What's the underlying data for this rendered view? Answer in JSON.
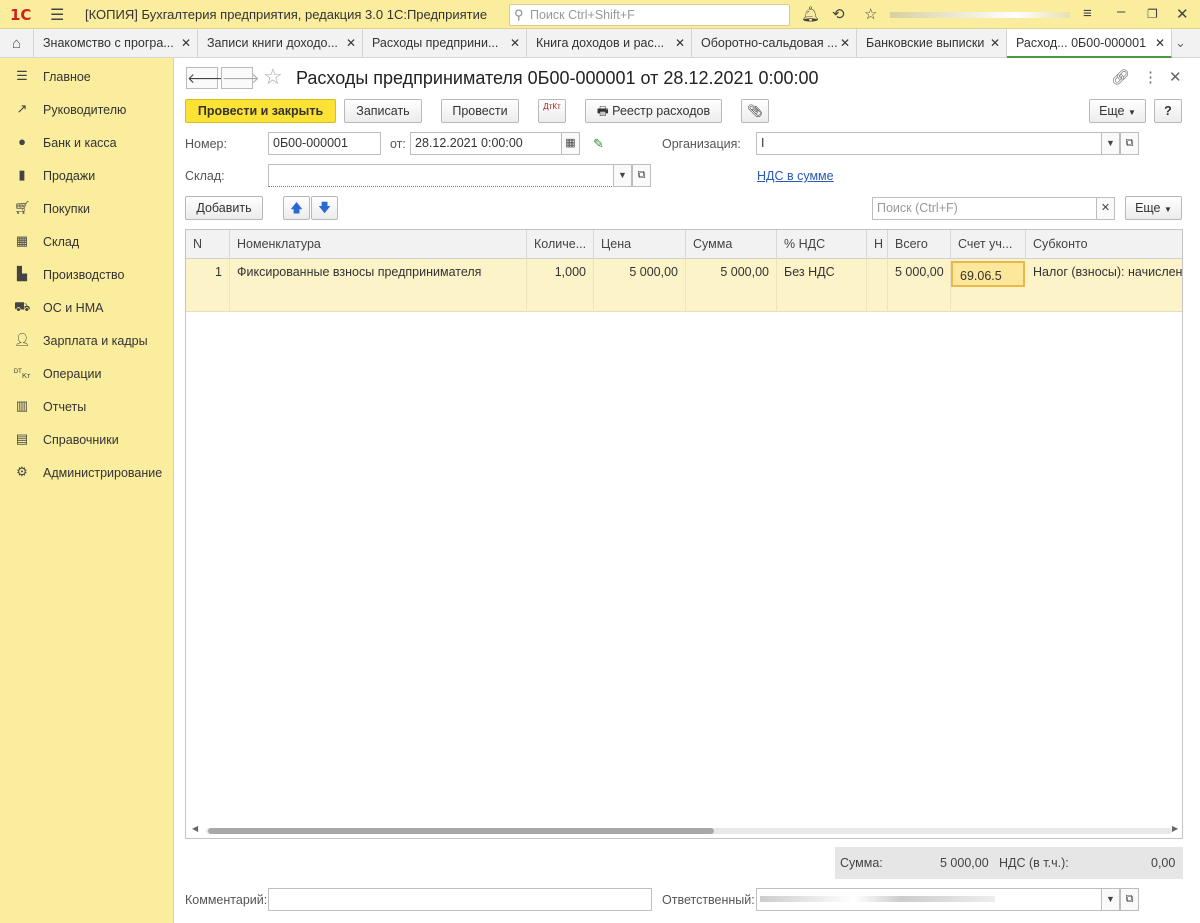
{
  "app": {
    "logo": "1С",
    "title": "[КОПИЯ] Бухгалтерия предприятия, редакция 3.0 1С:Предприятие",
    "search_placeholder": "Поиск Ctrl+Shift+F"
  },
  "tabs": [
    {
      "label": "Знакомство с програ..."
    },
    {
      "label": "Записи книги доходо..."
    },
    {
      "label": "Расходы предприни..."
    },
    {
      "label": "Книга доходов и рас..."
    },
    {
      "label": "Оборотно-сальдовая ..."
    },
    {
      "label": "Банковские выписки"
    },
    {
      "label": "Расход...  0Б00-000001"
    }
  ],
  "sidebar": {
    "items": [
      {
        "label": "Главное",
        "icon": "menu-icon"
      },
      {
        "label": "Руководителю",
        "icon": "trend-icon"
      },
      {
        "label": "Банк и касса",
        "icon": "coin-icon"
      },
      {
        "label": "Продажи",
        "icon": "bag-icon"
      },
      {
        "label": "Покупки",
        "icon": "cart-icon"
      },
      {
        "label": "Склад",
        "icon": "warehouse-icon"
      },
      {
        "label": "Производство",
        "icon": "factory-icon"
      },
      {
        "label": "ОС и НМА",
        "icon": "truck-icon"
      },
      {
        "label": "Зарплата и кадры",
        "icon": "person-icon"
      },
      {
        "label": "Операции",
        "icon": "dt-kt-icon"
      },
      {
        "label": "Отчеты",
        "icon": "chart-icon"
      },
      {
        "label": "Справочники",
        "icon": "book-icon"
      },
      {
        "label": "Администрирование",
        "icon": "gear-icon"
      }
    ]
  },
  "document": {
    "title": "Расходы предпринимателя 0Б00-000001 от 28.12.2021 0:00:00"
  },
  "toolbar": {
    "post_close": "Провести и закрыть",
    "save": "Записать",
    "post": "Провести",
    "dtkt": "ДтКт",
    "registry": "Реестр расходов",
    "more": "Еще"
  },
  "form": {
    "number_label": "Номер:",
    "number_value": "0Б00-000001",
    "date_label": "от:",
    "date_value": "28.12.2021  0:00:00",
    "org_label": "Организация:",
    "org_value": "І",
    "warehouse_label": "Склад:",
    "warehouse_value": "",
    "vat_link": "НДС в сумме"
  },
  "table_toolbar": {
    "add": "Добавить",
    "search_placeholder": "Поиск (Ctrl+F)",
    "more": "Еще"
  },
  "table": {
    "columns": [
      "N",
      "Номенклатура",
      "Количе...",
      "Цена",
      "Сумма",
      "% НДС",
      "Н",
      "Всего",
      "Счет уч...",
      "Субконто"
    ],
    "rows": [
      {
        "n": "1",
        "item": "Фиксированные взносы предпринимателя",
        "qty": "1,000",
        "price": "5 000,00",
        "sum": "5 000,00",
        "vat_rate": "Без НДС",
        "vat": "",
        "total": "5 000,00",
        "account": "69.06.5",
        "subconto": "Налог (взносы): начислено"
      }
    ]
  },
  "totals": {
    "sum_label": "Сумма:",
    "sum_value": "5 000,00",
    "vat_label": "НДС (в т.ч.):",
    "vat_value": "0,00"
  },
  "footer": {
    "comment_label": "Комментарий:",
    "comment_value": "",
    "responsible_label": "Ответственный:",
    "responsible_value": ""
  }
}
